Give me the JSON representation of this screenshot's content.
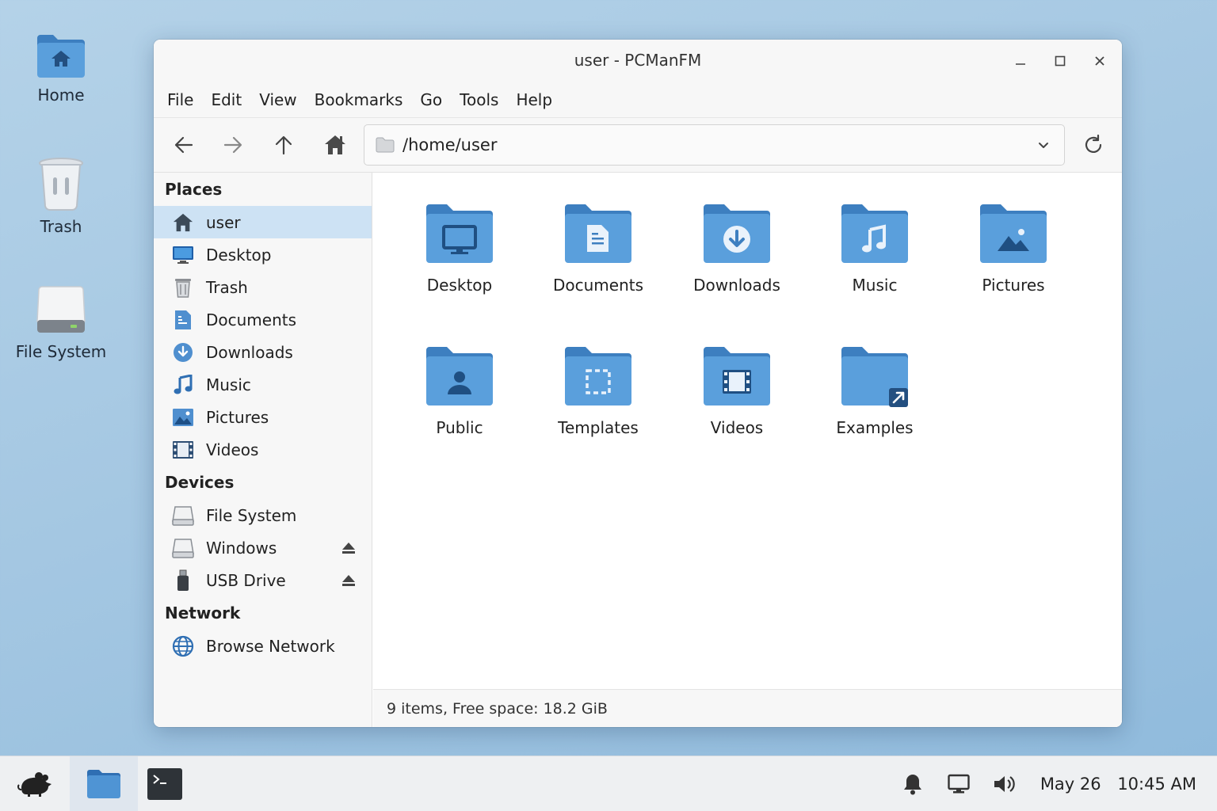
{
  "desktop": {
    "icons": [
      {
        "label": "Home",
        "icon": "home-folder-icon"
      },
      {
        "label": "Trash",
        "icon": "trash-icon"
      },
      {
        "label": "File System",
        "icon": "drive-icon"
      }
    ]
  },
  "window": {
    "title": "user - PCManFM",
    "menu": [
      "File",
      "Edit",
      "View",
      "Bookmarks",
      "Go",
      "Tools",
      "Help"
    ],
    "path": "/home/user"
  },
  "sidebar": {
    "places_header": "Places",
    "places": [
      {
        "label": "user",
        "icon": "home-icon",
        "selected": true
      },
      {
        "label": "Desktop",
        "icon": "monitor-icon"
      },
      {
        "label": "Trash",
        "icon": "trash-icon"
      },
      {
        "label": "Documents",
        "icon": "document-icon"
      },
      {
        "label": "Downloads",
        "icon": "download-icon"
      },
      {
        "label": "Music",
        "icon": "music-note-icon"
      },
      {
        "label": "Pictures",
        "icon": "picture-icon"
      },
      {
        "label": "Videos",
        "icon": "film-icon"
      }
    ],
    "devices_header": "Devices",
    "devices": [
      {
        "label": "File System",
        "icon": "drive-icon",
        "eject": false
      },
      {
        "label": "Windows",
        "icon": "drive-icon",
        "eject": true
      },
      {
        "label": "USB Drive",
        "icon": "usb-icon",
        "eject": true
      }
    ],
    "network_header": "Network",
    "network": [
      {
        "label": "Browse Network",
        "icon": "globe-icon"
      }
    ]
  },
  "files": [
    {
      "label": "Desktop",
      "emblem": "monitor"
    },
    {
      "label": "Documents",
      "emblem": "document"
    },
    {
      "label": "Downloads",
      "emblem": "download"
    },
    {
      "label": "Music",
      "emblem": "music"
    },
    {
      "label": "Pictures",
      "emblem": "picture"
    },
    {
      "label": "Public",
      "emblem": "person"
    },
    {
      "label": "Templates",
      "emblem": "template"
    },
    {
      "label": "Videos",
      "emblem": "film"
    },
    {
      "label": "Examples",
      "emblem": "link"
    }
  ],
  "status": "9 items, Free space: 18.2 GiB",
  "taskbar": {
    "date": "May 26",
    "time": "10:45 AM"
  },
  "colors": {
    "folder": "#4f94d4",
    "folder_tab": "#3d7fc0",
    "selection": "#cde2f4"
  }
}
